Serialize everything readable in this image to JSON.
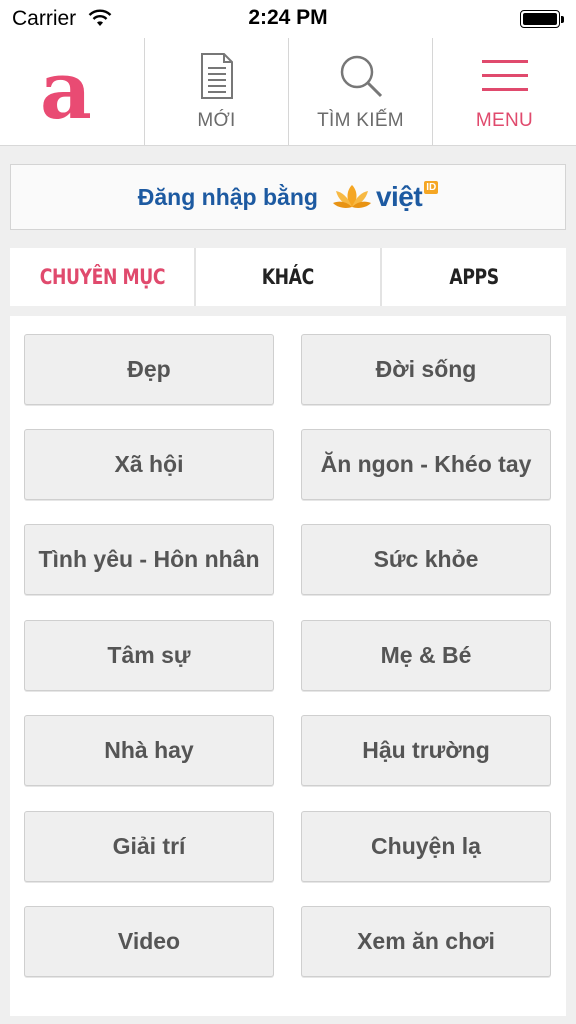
{
  "status_bar": {
    "carrier": "Carrier",
    "time": "2:24 PM"
  },
  "header": {
    "logo_letter": "a",
    "nav": [
      {
        "label": "MỚI",
        "icon": "document-icon"
      },
      {
        "label": "TÌM KIẾM",
        "icon": "search-icon"
      },
      {
        "label": "MENU",
        "icon": "hamburger-menu-icon"
      }
    ]
  },
  "login": {
    "text": "Đăng nhập bằng",
    "brand": "việt",
    "brand_badge": "ID"
  },
  "tabs": [
    {
      "label": "CHUYÊN MỤC",
      "active": true
    },
    {
      "label": "KHÁC",
      "active": false
    },
    {
      "label": "APPS",
      "active": false
    }
  ],
  "categories": [
    "Đẹp",
    "Đời sống",
    "Xã hội",
    "Ăn ngon - Khéo tay",
    "Tình yêu - Hôn nhân",
    "Sức khỏe",
    "Tâm sự",
    "Mẹ & Bé",
    "Nhà hay",
    "Hậu trường",
    "Giải trí",
    "Chuyện lạ",
    "Video",
    "Xem ăn chơi"
  ],
  "colors": {
    "accent": "#e04a6d",
    "brand_blue": "#1d5aa1",
    "nav_gray": "#6b6b6b"
  }
}
